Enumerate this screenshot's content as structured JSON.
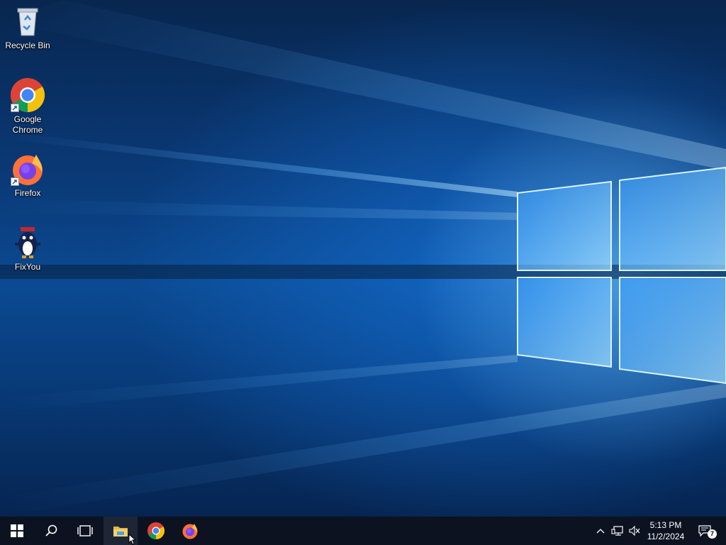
{
  "desktop": {
    "icons": [
      {
        "label": "Recycle Bin",
        "icon": "recycle-bin-icon"
      },
      {
        "label": "Google Chrome",
        "icon": "chrome-icon"
      },
      {
        "label": "Firefox",
        "icon": "firefox-icon"
      },
      {
        "label": "FixYou",
        "icon": "fixyou-icon"
      }
    ]
  },
  "taskbar": {
    "buttons": [
      {
        "icon": "windows-start-icon"
      },
      {
        "icon": "search-icon"
      },
      {
        "icon": "task-view-icon"
      },
      {
        "icon": "file-explorer-icon"
      },
      {
        "icon": "chrome-icon"
      },
      {
        "icon": "firefox-icon"
      }
    ],
    "tray": {
      "icons": [
        "chevron-up-icon",
        "network-icon",
        "speaker-muted-icon"
      ],
      "time": "5:13 PM",
      "date": "11/2/2024",
      "notification_count": "7"
    }
  },
  "colors": {
    "taskbar_bg": "#0c1220",
    "accent": "#76b9ed",
    "wallpaper_blue": "#0b4a92"
  }
}
